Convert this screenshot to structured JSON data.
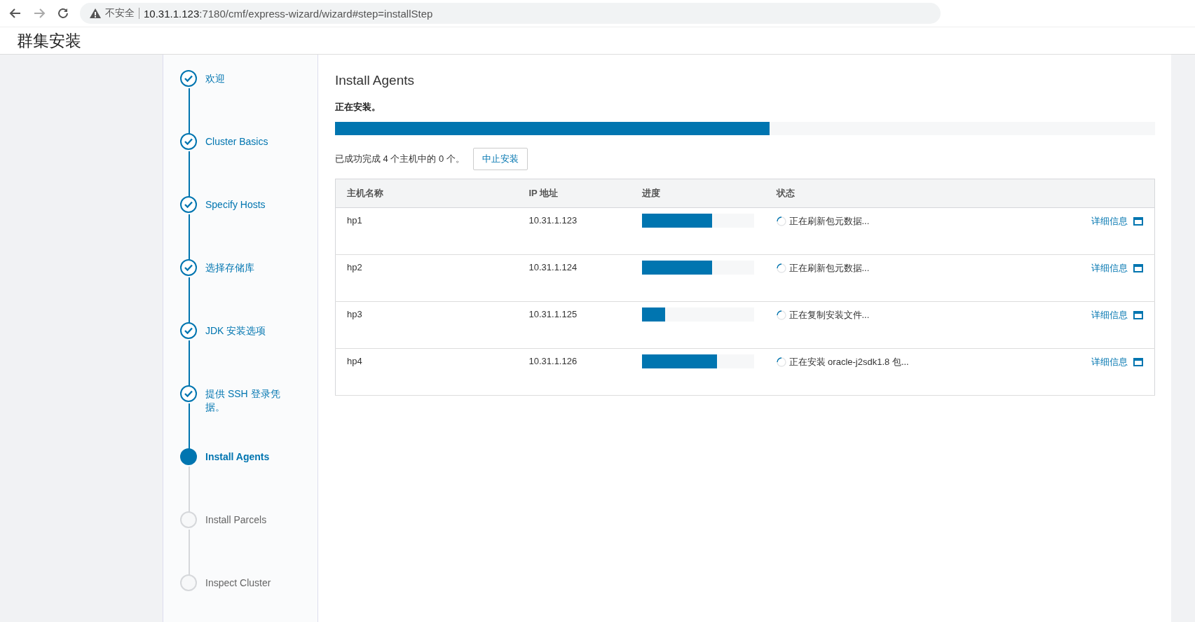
{
  "browser": {
    "security_label": "不安全",
    "url_host": "10.31.1.123",
    "url_path": ":7180/cmf/express-wizard/wizard#step=installStep"
  },
  "page_title": "群集安装",
  "steps": [
    {
      "label": "欢迎",
      "kind": "done"
    },
    {
      "label": "Cluster Basics",
      "kind": "done"
    },
    {
      "label": "Specify Hosts",
      "kind": "done"
    },
    {
      "label": "选择存储库",
      "kind": "done"
    },
    {
      "label": "JDK 安装选项",
      "kind": "done"
    },
    {
      "label": "提供 SSH 登录凭据。",
      "kind": "done"
    },
    {
      "label": "Install Agents",
      "kind": "current"
    },
    {
      "label": "Install Parcels",
      "kind": "pending"
    },
    {
      "label": "Inspect Cluster",
      "kind": "pending"
    }
  ],
  "main": {
    "title": "Install Agents",
    "status_text": "正在安装。",
    "overall_progress": {
      "level": 0.53
    },
    "summary": "已成功完成 4 个主机中的 0 个。",
    "abort_button": "中止安装"
  },
  "table": {
    "columns": [
      "主机名称",
      "IP 地址",
      "进度",
      "状态"
    ],
    "rows": [
      {
        "host": "hp1",
        "ip": "10.31.1.123",
        "level": 0.63,
        "status": "正在刷新包元数据...",
        "details": "详细信息"
      },
      {
        "host": "hp2",
        "ip": "10.31.1.124",
        "level": 0.63,
        "status": "正在刷新包元数据...",
        "details": "详细信息"
      },
      {
        "host": "hp3",
        "ip": "10.31.1.125",
        "level": 0.21,
        "status": "正在复制安装文件...",
        "details": "详细信息"
      },
      {
        "host": "hp4",
        "ip": "10.31.1.126",
        "level": 0.67,
        "status": "正在安装 oracle-j2sdk1.8 包...",
        "details": "详细信息"
      }
    ]
  }
}
